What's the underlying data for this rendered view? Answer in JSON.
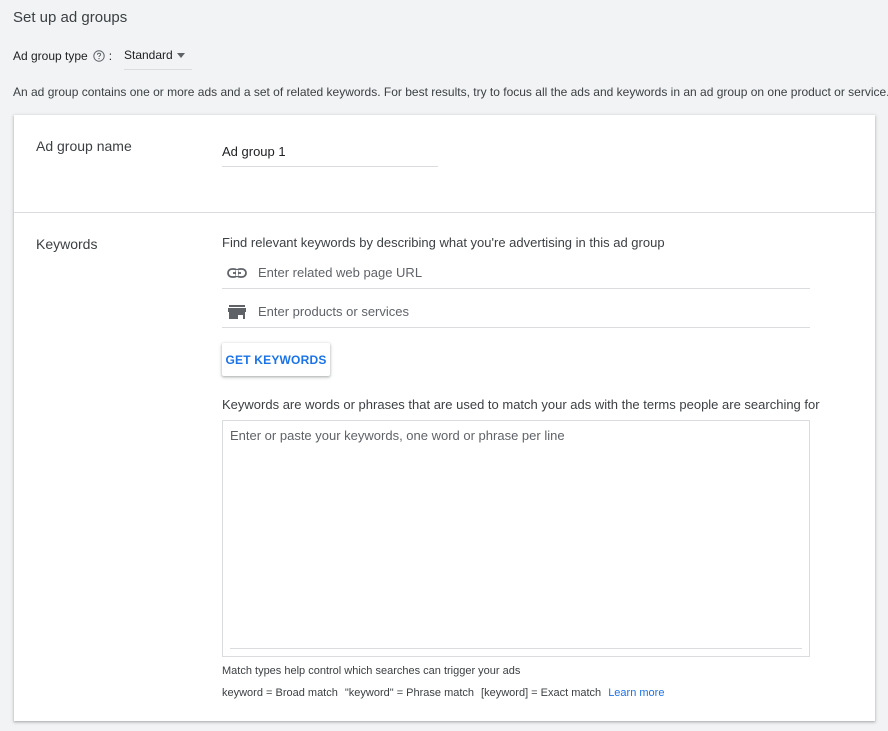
{
  "header": {
    "title": "Set up ad groups"
  },
  "ad_group_type": {
    "label": "Ad group type",
    "colon": ":",
    "help_icon": "help-circle-icon",
    "selected": "Standard"
  },
  "intro_text": "An ad group contains one or more ads and a set of related keywords. For best results, try to focus all the ads and keywords in an ad group on one product or service.",
  "ad_group_name": {
    "label": "Ad group name",
    "value": "Ad group 1"
  },
  "keywords": {
    "label": "Keywords",
    "find_text": "Find relevant keywords by describing what you're advertising in this ad group",
    "url_field": {
      "icon": "link-icon",
      "placeholder": "Enter related web page URL"
    },
    "products_field": {
      "icon": "store-icon",
      "placeholder": "Enter products or services"
    },
    "get_keywords_button": "GET KEYWORDS",
    "description": "Keywords are words or phrases that are used to match your ads with the terms people are searching for",
    "textarea_placeholder": "Enter or paste your keywords, one word or phrase per line",
    "match_help": "Match types help control which searches can trigger your ads",
    "match_types": {
      "broad": "keyword = Broad match",
      "phrase": "\"keyword\" = Phrase match",
      "exact": "[keyword] = Exact match",
      "learn_more": "Learn more"
    }
  },
  "colors": {
    "background": "#f1f3f4",
    "card": "#ffffff",
    "accent": "#1a73e8",
    "divider": "#dadce0"
  }
}
